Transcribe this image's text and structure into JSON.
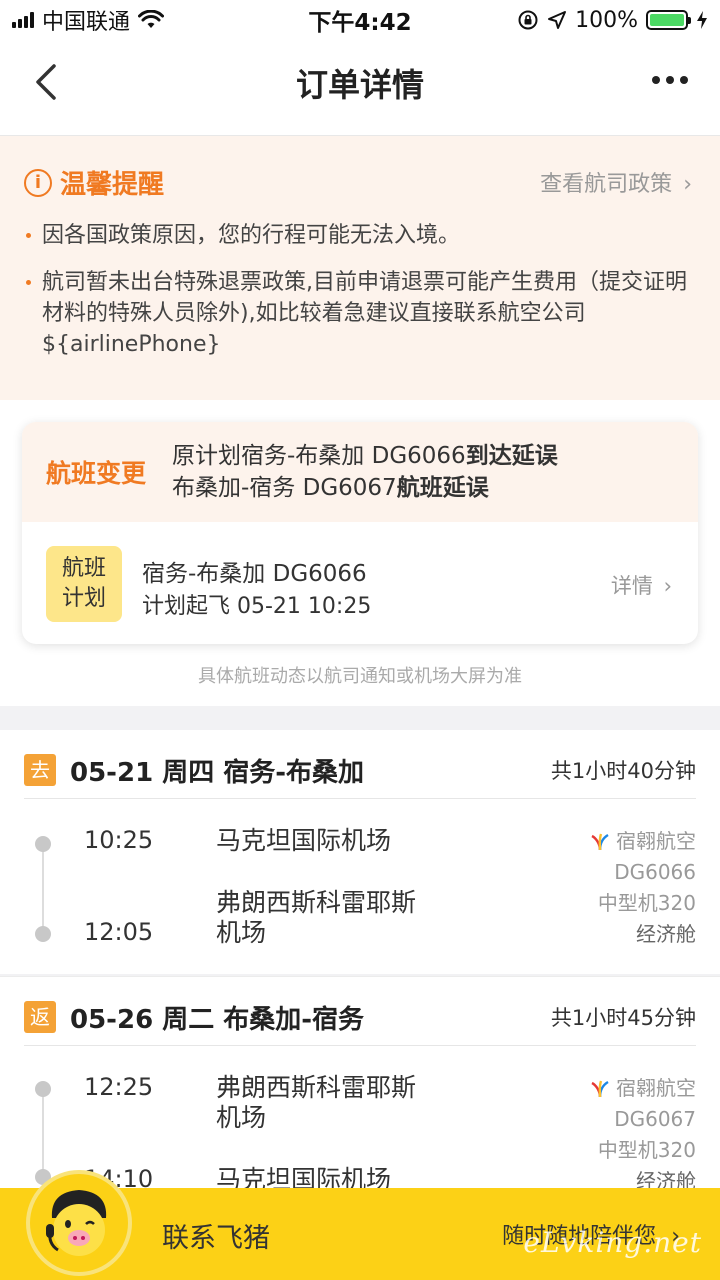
{
  "status_bar": {
    "carrier": "中国联通",
    "time": "下午4:42",
    "battery_percent": "100%",
    "battery_level": 1.0
  },
  "nav": {
    "title": "订单详情",
    "back_icon": "chevron-left-icon",
    "more_icon": "more-dots-icon"
  },
  "notice": {
    "title": "温馨提醒",
    "policy_link": "查看航司政策",
    "items": [
      "因各国政策原因，您的行程可能无法入境。",
      "航司暂未出台特殊退票政策,目前申请退票可能产生费用（提交证明材料的特殊人员除外),如比较着急建议直接联系航空公司${airlinePhone}"
    ]
  },
  "flight_change": {
    "label": "航班变更",
    "line1_prefix": "原计划宿务-布桑加 DG6066",
    "line1_status": "到达延误",
    "line2_prefix": "布桑加-宿务 DG6067",
    "line2_status": "航班延误",
    "plan_badge_line1": "航班",
    "plan_badge_line2": "计划",
    "plan_route": "宿务-布桑加 DG6066",
    "plan_time": "计划起飞 05-21 10:25",
    "detail_link": "详情",
    "note": "具体航班动态以航司通知或机场大屏为准"
  },
  "segments": [
    {
      "badge": "去",
      "title": "05-21 周四 宿务-布桑加",
      "total": "共1小时40分钟",
      "dep_time": "10:25",
      "dep_airport": "马克坦国际机场",
      "arr_time": "12:05",
      "arr_airport_line1": "弗朗西斯科雷耶斯",
      "arr_airport_line2": "机场",
      "airline": "宿翱航空",
      "flight_no": "DG6066",
      "aircraft": "中型机320",
      "cabin": "经济舱"
    },
    {
      "badge": "返",
      "title": "05-26 周二 布桑加-宿务",
      "total": "共1小时45分钟",
      "dep_time": "12:25",
      "dep_airport_line1": "弗朗西斯科雷耶斯",
      "dep_airport_line2": "机场",
      "arr_time": "14:10",
      "arr_airport": "马克坦国际机场",
      "airline": "宿翱航空",
      "flight_no": "DG6067",
      "aircraft": "中型机320",
      "cabin": "经济舱"
    }
  ],
  "bottom_bar": {
    "title": "联系飞猪",
    "subtitle": "随时随地陪伴您",
    "watermark": "eLvking.net"
  },
  "colors": {
    "accent_orange": "#f07a22",
    "notice_bg": "#fdf3ec",
    "bottom_yellow": "#fcd116",
    "plan_badge": "#fde68a"
  }
}
